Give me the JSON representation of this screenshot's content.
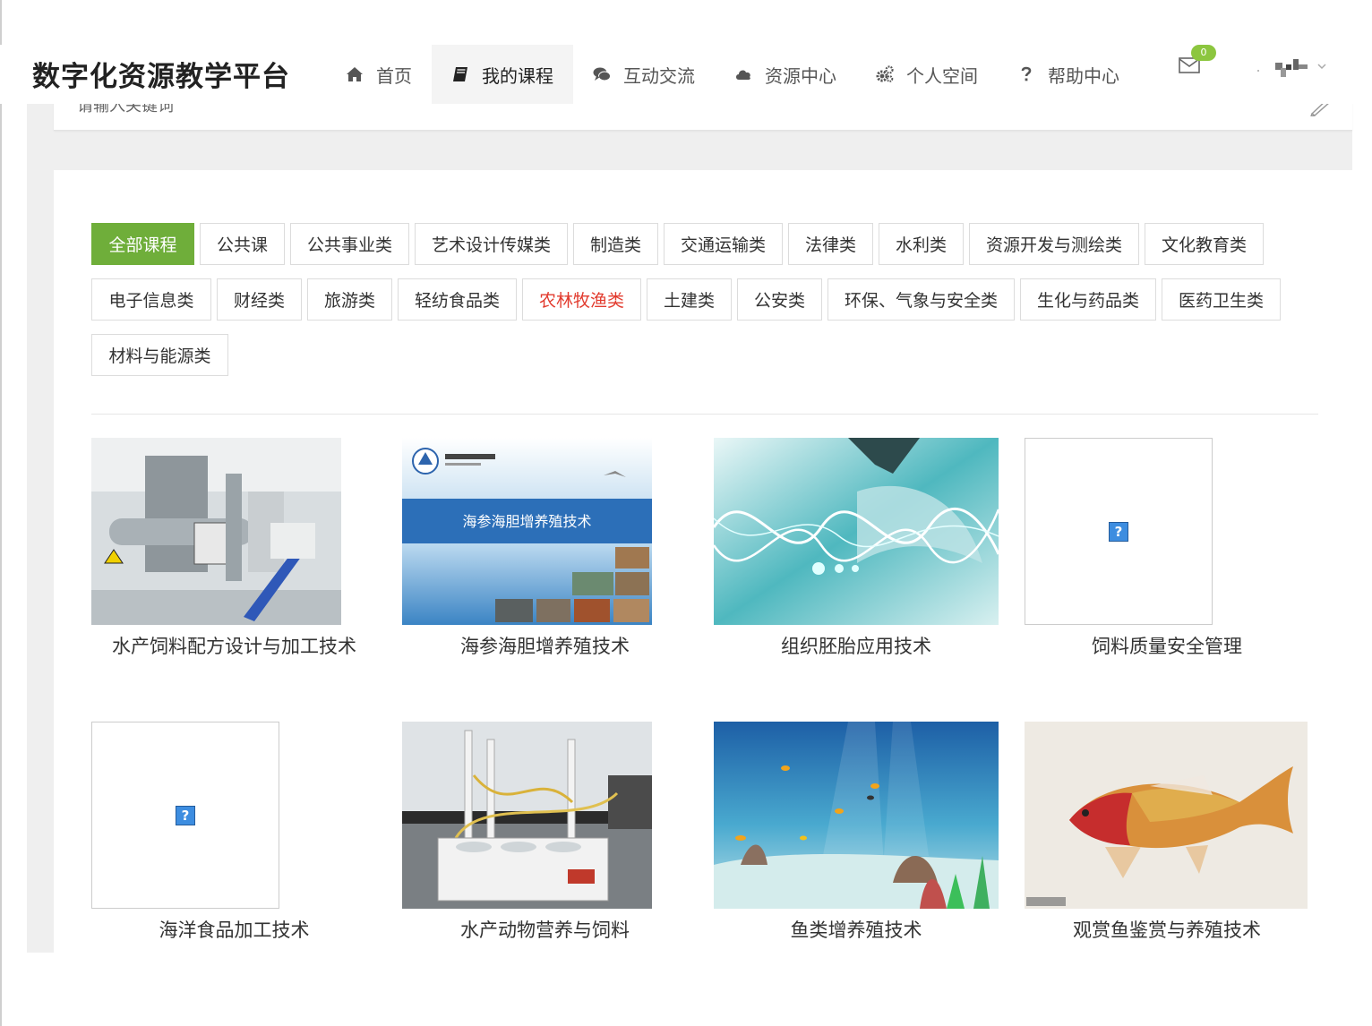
{
  "app": {
    "title": "数字化资源教学平台"
  },
  "nav": [
    {
      "label": "首页",
      "icon": "home-icon"
    },
    {
      "label": "我的课程",
      "icon": "book-icon",
      "active": true
    },
    {
      "label": "互动交流",
      "icon": "chat-icon"
    },
    {
      "label": "资源中心",
      "icon": "cloud-icon"
    },
    {
      "label": "个人空间",
      "icon": "gears-icon"
    },
    {
      "label": "帮助中心",
      "icon": "question-icon"
    }
  ],
  "messages": {
    "count": "0",
    "icon": "envelope-icon"
  },
  "search": {
    "placeholder": "请输入关键词"
  },
  "categories": [
    {
      "label": "全部课程",
      "active": true
    },
    {
      "label": "公共课"
    },
    {
      "label": "公共事业类"
    },
    {
      "label": "艺术设计传媒类"
    },
    {
      "label": "制造类"
    },
    {
      "label": "交通运输类"
    },
    {
      "label": "法律类"
    },
    {
      "label": "水利类"
    },
    {
      "label": "资源开发与测绘类"
    },
    {
      "label": "文化教育类"
    },
    {
      "label": "电子信息类"
    },
    {
      "label": "财经类"
    },
    {
      "label": "旅游类"
    },
    {
      "label": "轻纺食品类"
    },
    {
      "label": "农林牧渔类",
      "highlight": true
    },
    {
      "label": "土建类"
    },
    {
      "label": "公安类"
    },
    {
      "label": "环保、气象与安全类"
    },
    {
      "label": "生化与药品类"
    },
    {
      "label": "医药卫生类"
    },
    {
      "label": "材料与能源类"
    }
  ],
  "courses": [
    {
      "title": "水产饲料配方设计与加工技术",
      "image": "feed-factory-photo"
    },
    {
      "title": "海参海胆增养殖技术",
      "image": "sea-cucumber-cover",
      "cover_text": "海参海胆增养殖技术"
    },
    {
      "title": "组织胚胎应用技术",
      "image": "embryo-waves-art"
    },
    {
      "title": "饲料质量安全管理",
      "image": "broken-image"
    },
    {
      "title": "海洋食品加工技术",
      "image": "broken-image"
    },
    {
      "title": "水产动物营养与饲料",
      "image": "lab-glassware-photo"
    },
    {
      "title": "鱼类增养殖技术",
      "image": "underwater-reef"
    },
    {
      "title": "观赏鱼鉴赏与养殖技术",
      "image": "koi-painting"
    }
  ],
  "colors": {
    "accent": "#6fae3a",
    "highlight": "#e23b2e",
    "badge": "#8cc63f"
  }
}
